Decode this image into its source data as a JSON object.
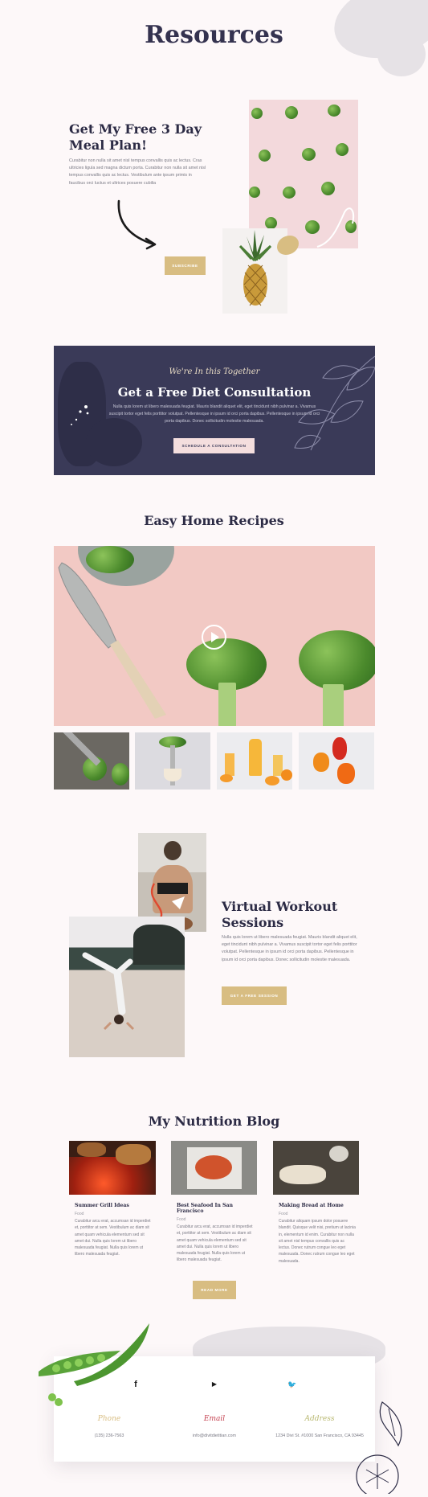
{
  "page": {
    "title": "Resources"
  },
  "meal_plan": {
    "title_line1": "Get My Free 3 Day",
    "title_line2": "Meal Plan!",
    "body": "Curabitur non nulla sit amet nisl tempus convallis quis ac lectus. Cras ultricies ligula sed magna dictum porta. Curabitur non nulla sit amet nisl tempus convallis quis ac lectus. Vestibulum ante ipsum primis in faucibus orci luctus et ultrices posuere cubilia",
    "button": "Subscribe"
  },
  "consultation": {
    "script_title": "We're In this Together",
    "title": "Get a Free Diet Consultation",
    "body": "Nulla quis lorem ut libero malesuada feugiat. Mauris blandit aliquet elit, eget tincidunt nibh pulvinar a. Vivamus suscipit tortor eget felis porttitor volutpat. Pellentesque in ipsum id orci porta dapibus. Pellentesque in ipsum id orci porta dapibus. Donec sollicitudin molestie malesuada.",
    "button": "Schedule a Consultation"
  },
  "recipes": {
    "title": "Easy Home Recipes"
  },
  "workout": {
    "title_line1": "Virtual Workout",
    "title_line2": "Sessions",
    "body": "Nulla quis lorem ut libero malesuada feugiat. Mauris blandit aliquet elit, eget tincidunt nibh pulvinar a. Vivamus suscipit tortor eget felis porttitor volutpat. Pellentesque in ipsum id orci porta dapibus. Pellentesque in ipsum id orci porta dapibus. Donec sollicitudin molestie malesuada.",
    "button": "Get a Free Session"
  },
  "blog": {
    "title": "My Nutrition Blog",
    "button": "Read More",
    "posts": [
      {
        "title": "Summer Grill Ideas",
        "category": "Food",
        "excerpt": "Curabitur arcu erat, accumsan id imperdiet et, porttitor at sem. Vestibulum ac diam sit amet quam vehicula elementum sed sit amet dui. Nulla quis lorem ut libero malesuada feugiat. Nulla quis lorem ut libero malesuada feugiat."
      },
      {
        "title": "Best Seafood In San Francisco",
        "category": "Food",
        "excerpt": "Curabitur arcu erat, accumsan id imperdiet et, porttitor at sem. Vestibulum ac diam sit amet quam vehicula elementum sed sit amet dui. Nulla quis lorem ut libero malesuada feugiat. Nulla quis lorem ut libero malesuada feugiat."
      },
      {
        "title": "Making Bread at Home",
        "category": "Food",
        "excerpt": "Curabitur aliquam ipsum dolor posuere blandit. Quisque velit nisi, pretium ut lacinia in, elementum id enim. Curabitur non nulla sit amet nisl tempus convallis quis ac lectus. Donec rutrum congue leo eget malesuada. Donec rutrum congue leo eget malesuada."
      }
    ]
  },
  "footer": {
    "social": [
      "f",
      "▶",
      "🐦"
    ],
    "contacts": [
      {
        "label": "Phone",
        "value": "(135) 236-7563",
        "color": "#d8bd82"
      },
      {
        "label": "Email",
        "value": "info@divitdietitian.com",
        "color": "#c4404f"
      },
      {
        "label": "Address",
        "value": "1234 Divi St. #1000 San Francisco, CA 93445",
        "color": "#b8b870"
      }
    ]
  },
  "colors": {
    "navy": "#3a3a58",
    "gold": "#d8bd82",
    "bg": "#fdf8f9"
  }
}
